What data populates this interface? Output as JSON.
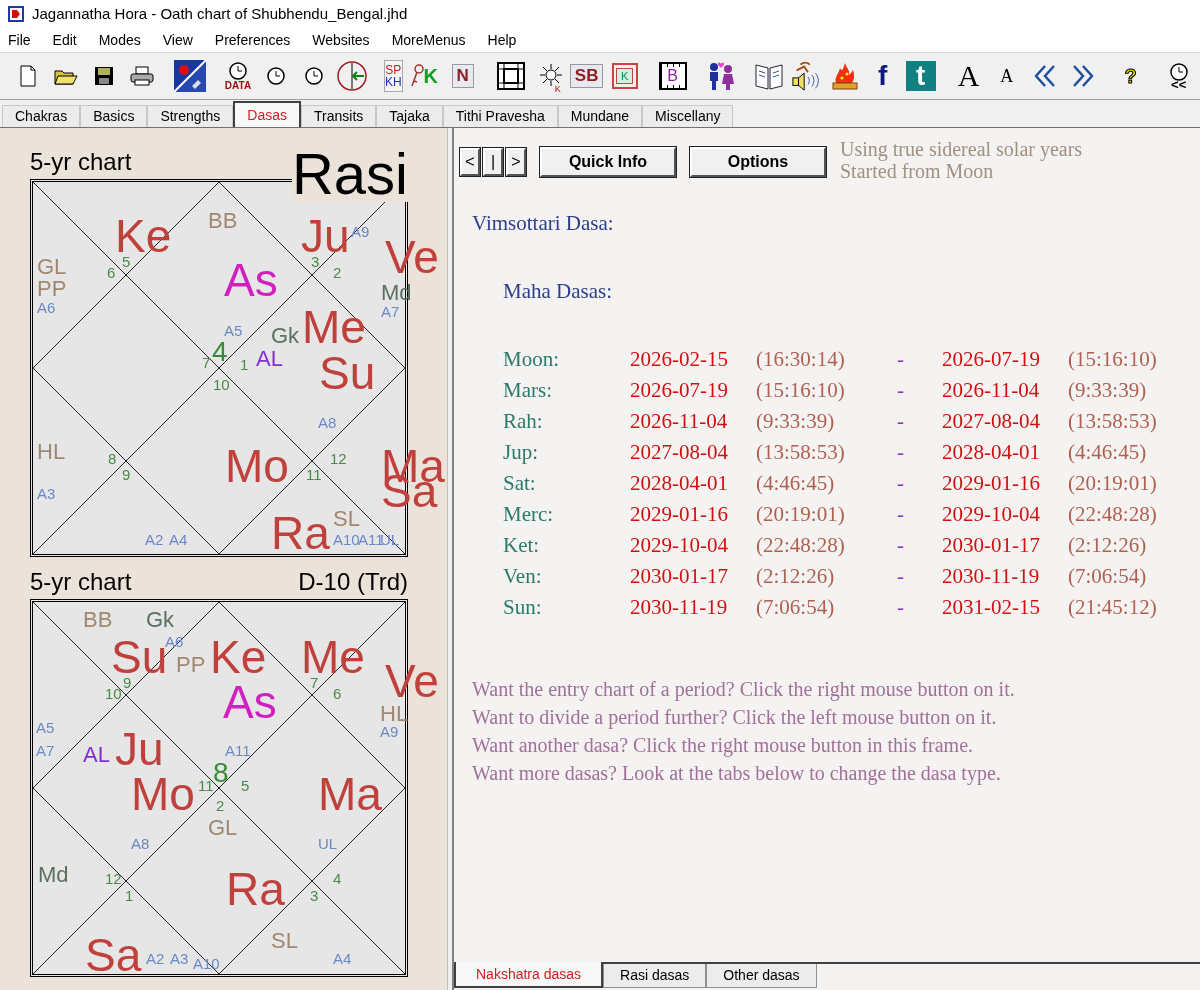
{
  "window": {
    "title": "Jagannatha Hora - Oath chart of Shubhendu_Bengal.jhd"
  },
  "menu": [
    "File",
    "Edit",
    "Modes",
    "View",
    "Preferences",
    "Websites",
    "MoreMenus",
    "Help"
  ],
  "toolbar": [
    {
      "kind": "new"
    },
    {
      "kind": "open"
    },
    {
      "kind": "save"
    },
    {
      "kind": "print"
    },
    {
      "kind": "separator"
    },
    {
      "kind": "sky"
    },
    {
      "kind": "separator"
    },
    {
      "kind": "clock_data",
      "text": "DATA"
    },
    {
      "kind": "clock_x"
    },
    {
      "kind": "clock_back"
    },
    {
      "kind": "tz"
    },
    {
      "kind": "separator"
    },
    {
      "kind": "stacked",
      "text": "SP",
      "text2": "KH"
    },
    {
      "kind": "key",
      "text": "K"
    },
    {
      "kind": "boxed_letter",
      "text": "N"
    },
    {
      "kind": "separator"
    },
    {
      "kind": "grid"
    },
    {
      "kind": "sun",
      "text": "K"
    },
    {
      "kind": "boxed_letter",
      "text": "SB"
    },
    {
      "kind": "framed_letter",
      "text": "K"
    },
    {
      "kind": "separator"
    },
    {
      "kind": "grid_letter",
      "text": "B"
    },
    {
      "kind": "separator"
    },
    {
      "kind": "people"
    },
    {
      "kind": "separator"
    },
    {
      "kind": "book"
    },
    {
      "kind": "speaker"
    },
    {
      "kind": "fire"
    },
    {
      "kind": "facebook",
      "text": "f"
    },
    {
      "kind": "twitter",
      "text": "t"
    },
    {
      "kind": "separator"
    },
    {
      "kind": "font_big",
      "text": "A"
    },
    {
      "kind": "font_small",
      "text": "A"
    },
    {
      "kind": "prev"
    },
    {
      "kind": "next"
    },
    {
      "kind": "separator"
    },
    {
      "kind": "help",
      "text": "?"
    },
    {
      "kind": "separator"
    },
    {
      "kind": "clock_rewind",
      "text": "<<"
    }
  ],
  "tabs": [
    {
      "label": "Chakras",
      "selected": false
    },
    {
      "label": "Basics",
      "selected": false
    },
    {
      "label": "Strengths",
      "selected": false
    },
    {
      "label": "Dasas",
      "selected": true
    },
    {
      "label": "Transits",
      "selected": false
    },
    {
      "label": "Tajaka",
      "selected": false
    },
    {
      "label": "Tithi Pravesha",
      "selected": false
    },
    {
      "label": "Mundane",
      "selected": false
    },
    {
      "label": "Miscellany",
      "selected": false
    }
  ],
  "charts": [
    {
      "title": "5-yr chart",
      "name": "Rasi",
      "labels": [
        {
          "text": "Ke",
          "kind": "planet"
        },
        {
          "text": "BB",
          "kind": "upagraha"
        },
        {
          "text": "Ju",
          "kind": "planet"
        },
        {
          "text": "A9",
          "kind": "arudha"
        },
        {
          "text": "GL",
          "kind": "upagraha"
        },
        {
          "text": "PP",
          "kind": "upagraha"
        },
        {
          "text": "A6",
          "kind": "arudha"
        },
        {
          "text": "6",
          "kind": "house"
        },
        {
          "text": "5",
          "kind": "house"
        },
        {
          "text": "As",
          "kind": "lagna"
        },
        {
          "text": "3",
          "kind": "house"
        },
        {
          "text": "2",
          "kind": "house"
        },
        {
          "text": "Ve",
          "kind": "planet"
        },
        {
          "text": "Md",
          "kind": "special"
        },
        {
          "text": "A7",
          "kind": "arudha"
        },
        {
          "text": "A5",
          "kind": "arudha"
        },
        {
          "text": "Gk",
          "kind": "special"
        },
        {
          "text": "Me",
          "kind": "planet"
        },
        {
          "text": "4",
          "kind": "house_main"
        },
        {
          "text": "7",
          "kind": "house"
        },
        {
          "text": "1",
          "kind": "house"
        },
        {
          "text": "AL",
          "kind": "arudha_lagna"
        },
        {
          "text": "10",
          "kind": "house"
        },
        {
          "text": "Su",
          "kind": "planet"
        },
        {
          "text": "A8",
          "kind": "arudha"
        },
        {
          "text": "HL",
          "kind": "upagraha"
        },
        {
          "text": "8",
          "kind": "house"
        },
        {
          "text": "9",
          "kind": "house"
        },
        {
          "text": "Mo",
          "kind": "planet"
        },
        {
          "text": "12",
          "kind": "house"
        },
        {
          "text": "11",
          "kind": "house"
        },
        {
          "text": "A3",
          "kind": "arudha"
        },
        {
          "text": "Ma",
          "kind": "planet"
        },
        {
          "text": "SL",
          "kind": "upagraha"
        },
        {
          "text": "Sa",
          "kind": "planet"
        },
        {
          "text": "A2",
          "kind": "arudha"
        },
        {
          "text": "A4",
          "kind": "arudha"
        },
        {
          "text": "Ra",
          "kind": "planet"
        },
        {
          "text": "A10",
          "kind": "arudha"
        },
        {
          "text": "A11",
          "kind": "arudha"
        },
        {
          "text": "UL",
          "kind": "arudha"
        }
      ]
    },
    {
      "title": "5-yr chart",
      "name": "D-10 (Trd)",
      "labels": [
        {
          "text": "BB",
          "kind": "upagraha"
        },
        {
          "text": "Gk",
          "kind": "special"
        },
        {
          "text": "Su",
          "kind": "planet"
        },
        {
          "text": "A6",
          "kind": "arudha"
        },
        {
          "text": "PP",
          "kind": "upagraha"
        },
        {
          "text": "Ke",
          "kind": "planet"
        },
        {
          "text": "Me",
          "kind": "planet"
        },
        {
          "text": "9",
          "kind": "house"
        },
        {
          "text": "10",
          "kind": "house"
        },
        {
          "text": "As",
          "kind": "lagna"
        },
        {
          "text": "7",
          "kind": "house"
        },
        {
          "text": "6",
          "kind": "house"
        },
        {
          "text": "Ve",
          "kind": "planet"
        },
        {
          "text": "HL",
          "kind": "upagraha"
        },
        {
          "text": "A9",
          "kind": "arudha"
        },
        {
          "text": "A5",
          "kind": "arudha"
        },
        {
          "text": "A7",
          "kind": "arudha"
        },
        {
          "text": "AL",
          "kind": "arudha_lagna"
        },
        {
          "text": "Ju",
          "kind": "planet"
        },
        {
          "text": "Mo",
          "kind": "planet"
        },
        {
          "text": "A11",
          "kind": "arudha"
        },
        {
          "text": "8",
          "kind": "house_main"
        },
        {
          "text": "11",
          "kind": "house"
        },
        {
          "text": "5",
          "kind": "house"
        },
        {
          "text": "2",
          "kind": "house"
        },
        {
          "text": "Ma",
          "kind": "planet"
        },
        {
          "text": "GL",
          "kind": "upagraha"
        },
        {
          "text": "A8",
          "kind": "arudha"
        },
        {
          "text": "UL",
          "kind": "arudha"
        },
        {
          "text": "Md",
          "kind": "special"
        },
        {
          "text": "12",
          "kind": "house"
        },
        {
          "text": "1",
          "kind": "house"
        },
        {
          "text": "Ra",
          "kind": "planet"
        },
        {
          "text": "4",
          "kind": "house"
        },
        {
          "text": "3",
          "kind": "house"
        },
        {
          "text": "SL",
          "kind": "upagraha"
        },
        {
          "text": "Sa",
          "kind": "planet"
        },
        {
          "text": "A2",
          "kind": "arudha"
        },
        {
          "text": "A3",
          "kind": "arudha"
        },
        {
          "text": "A10",
          "kind": "arudha"
        },
        {
          "text": "A4",
          "kind": "arudha"
        }
      ]
    }
  ],
  "dasa_panel": {
    "nav_buttons": [
      "<",
      "|",
      ">"
    ],
    "buttons": [
      "Quick Info",
      "Options"
    ],
    "notes": [
      "Using true sidereal solar years",
      "Started from Moon"
    ],
    "heading": "Vimsottari Dasa:",
    "subheading": "Maha Dasas:",
    "rows": [
      {
        "name": "Moon:",
        "start_date": "2026-02-15",
        "start_time": "(16:30:14)",
        "dash": "-",
        "end_date": "2026-07-19",
        "end_time": "(15:16:10)"
      },
      {
        "name": "Mars:",
        "start_date": "2026-07-19",
        "start_time": "(15:16:10)",
        "dash": "-",
        "end_date": "2026-11-04",
        "end_time": "(9:33:39)"
      },
      {
        "name": "Rah:",
        "start_date": "2026-11-04",
        "start_time": "(9:33:39)",
        "dash": "-",
        "end_date": "2027-08-04",
        "end_time": "(13:58:53)"
      },
      {
        "name": "Jup:",
        "start_date": "2027-08-04",
        "start_time": "(13:58:53)",
        "dash": "-",
        "end_date": "2028-04-01",
        "end_time": "(4:46:45)"
      },
      {
        "name": "Sat:",
        "start_date": "2028-04-01",
        "start_time": "(4:46:45)",
        "dash": "-",
        "end_date": "2029-01-16",
        "end_time": "(20:19:01)"
      },
      {
        "name": "Merc:",
        "start_date": "2029-01-16",
        "start_time": "(20:19:01)",
        "dash": "-",
        "end_date": "2029-10-04",
        "end_time": "(22:48:28)"
      },
      {
        "name": "Ket:",
        "start_date": "2029-10-04",
        "start_time": "(22:48:28)",
        "dash": "-",
        "end_date": "2030-01-17",
        "end_time": "(2:12:26)"
      },
      {
        "name": "Ven:",
        "start_date": "2030-01-17",
        "start_time": "(2:12:26)",
        "dash": "-",
        "end_date": "2030-11-19",
        "end_time": "(7:06:54)"
      },
      {
        "name": "Sun:",
        "start_date": "2030-11-19",
        "start_time": "(7:06:54)",
        "dash": "-",
        "end_date": "2031-02-15",
        "end_time": "(21:45:12)"
      }
    ],
    "help": [
      "Want the entry chart of a period? Click the right mouse button on it.",
      "Want to divide a period further? Click the left mouse button on it.",
      "Want another dasa? Click the right mouse button in this frame.",
      "Want more dasas? Look at the tabs below to change the dasa type."
    ],
    "tabs": [
      {
        "label": "Nakshatra dasas",
        "selected": true
      },
      {
        "label": "Rasi dasas",
        "selected": false
      },
      {
        "label": "Other dasas",
        "selected": false
      }
    ]
  }
}
